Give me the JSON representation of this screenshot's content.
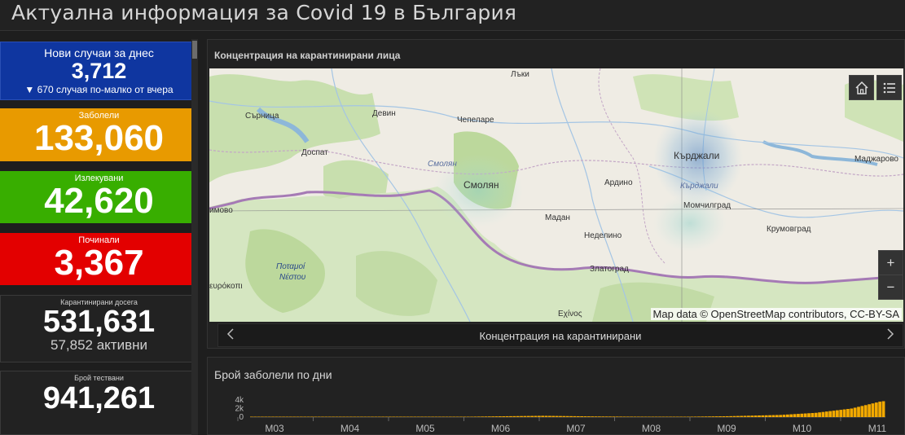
{
  "header": {
    "title": "Актуална информация за Covid 19 в България"
  },
  "cards": {
    "new": {
      "label": "Нови случаи за днес",
      "value": "3,712",
      "sub": "▼ 670 случая по-малко от вчера"
    },
    "sick": {
      "label": "Заболели",
      "value": "133,060"
    },
    "healed": {
      "label": "Излекувани",
      "value": "42,620"
    },
    "dead": {
      "label": "Починали",
      "value": "3,367"
    },
    "quarantined": {
      "label": "Карантинирани досега",
      "value": "531,631",
      "active": "57,852 активни"
    },
    "tested": {
      "label": "Брой тествани",
      "value": "941,261"
    }
  },
  "colors": {
    "new": "#0f36a0",
    "sick": "#e89a00",
    "healed": "#38ae00",
    "dead": "#e30000",
    "bars": "#f2a900"
  },
  "map": {
    "title": "Концентрация на карантинирани лица",
    "attribution": "Map data © OpenStreetMap contributors, CC-BY-SA",
    "home_icon": "home-icon",
    "legend_icon": "list-icon",
    "zoom_in": "+",
    "zoom_out": "−",
    "places": {
      "laki": "Лъки",
      "sarnitsa": "Сърница",
      "devin": "Девин",
      "chepelare": "Чепеларе",
      "dospat": "Доспат",
      "smolyan_region": "Смолян",
      "smolyan": "Смолян",
      "kardzhali": "Кърджали",
      "kardzhali_region": "Кърджали",
      "madzharovo": "Маджарово",
      "ardino": "Ардино",
      "momchilgrad": "Момчилград",
      "madan": "Мадан",
      "nedelino": "Неделино",
      "krumovgrad": "Крумовград",
      "zlatograd": "Златоград",
      "dimovo": "имово",
      "potamoi": "Ποταμοί",
      "nestou": "Νέστου",
      "evrokopi": "ευρόκοπι",
      "echinos": "Εχίνος"
    }
  },
  "carousel": {
    "title": "Концентрация на карантинирани",
    "prev_icon": "chevron-left-icon",
    "next_icon": "chevron-right-icon"
  },
  "chart_data": {
    "type": "bar",
    "title": "Брой заболели по дни",
    "x_ticks": [
      "M03",
      "M04",
      "M05",
      "M06",
      "M07",
      "M08",
      "M09",
      "M10",
      "M11"
    ],
    "y_ticks": [
      "4k",
      "2k",
      "0"
    ],
    "ylim": [
      0,
      4000
    ],
    "x_range": [
      "M03",
      "M11"
    ],
    "values": [
      0,
      0,
      1,
      2,
      3,
      5,
      7,
      10,
      12,
      15,
      18,
      20,
      22,
      25,
      20,
      18,
      22,
      25,
      28,
      30,
      35,
      40,
      45,
      42,
      38,
      35,
      30,
      28,
      25,
      30,
      35,
      38,
      40,
      42,
      40,
      38,
      35,
      30,
      28,
      25,
      22,
      20,
      25,
      30,
      28,
      25,
      22,
      20,
      18,
      15,
      18,
      20,
      22,
      25,
      28,
      30,
      35,
      45,
      55,
      65,
      75,
      85,
      95,
      110,
      120,
      130,
      140,
      150,
      160,
      170,
      180,
      190,
      200,
      210,
      220,
      230,
      240,
      250,
      260,
      270,
      280,
      290,
      300,
      290,
      280,
      270,
      260,
      250,
      240,
      230,
      220,
      210,
      200,
      190,
      180,
      170,
      160,
      150,
      145,
      140,
      135,
      130,
      125,
      120,
      115,
      110,
      108,
      106,
      104,
      102,
      100,
      98,
      96,
      94,
      92,
      90,
      88,
      86,
      84,
      82,
      80,
      85,
      90,
      95,
      100,
      110,
      120,
      130,
      140,
      150,
      160,
      170,
      180,
      190,
      200,
      220,
      240,
      260,
      280,
      300,
      320,
      340,
      360,
      380,
      400,
      420,
      440,
      460,
      480,
      500,
      550,
      600,
      650,
      700,
      750,
      800,
      850,
      900,
      950,
      1000,
      1100,
      1200,
      1300,
      1400,
      1500,
      1600,
      1700,
      1800,
      1900,
      2000,
      2200,
      2400,
      2600,
      2800,
      3000,
      3200,
      3400,
      3600,
      3712
    ],
    "bar_color": "#f2a900",
    "data_labels_note": ""
  }
}
